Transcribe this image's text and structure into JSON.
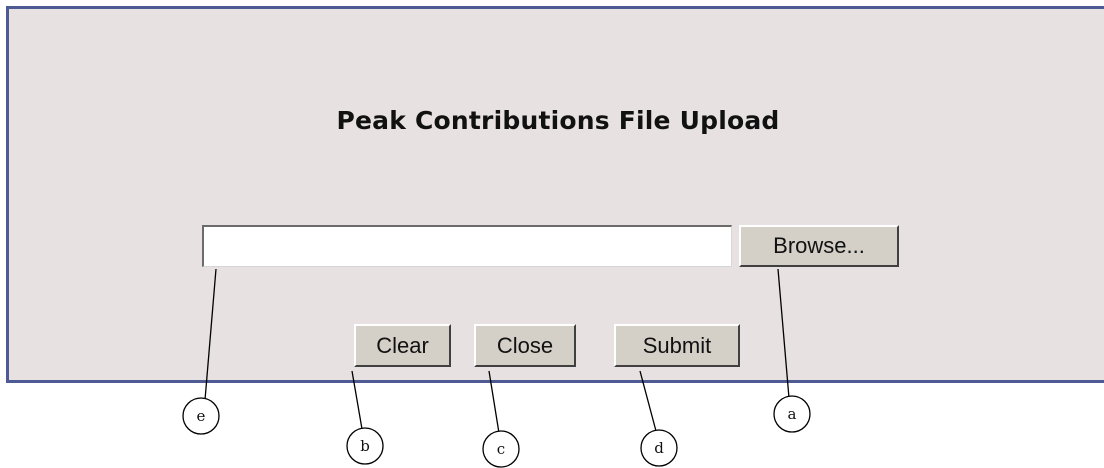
{
  "dialog": {
    "title": "Peak Contributions File Upload",
    "file_input_value": "",
    "browse_label": "Browse...",
    "buttons": {
      "clear": "Clear",
      "close": "Close",
      "submit": "Submit"
    }
  },
  "callouts": {
    "a": "a",
    "b": "b",
    "c": "c",
    "d": "d",
    "e": "e"
  },
  "colors": {
    "dialog_background": "#e8e1e1",
    "dialog_border": "#4e5a93",
    "button_face": "#d4d0c8"
  }
}
